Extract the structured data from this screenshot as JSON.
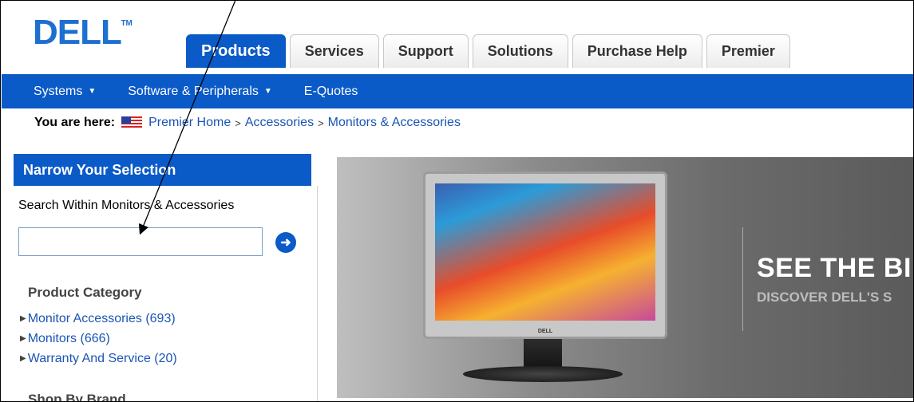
{
  "logo": {
    "text": "DELL",
    "tm": "TM"
  },
  "tabs": [
    {
      "label": "Products",
      "active": true
    },
    {
      "label": "Services",
      "active": false
    },
    {
      "label": "Support",
      "active": false
    },
    {
      "label": "Solutions",
      "active": false
    },
    {
      "label": "Purchase Help",
      "active": false
    },
    {
      "label": "Premier",
      "active": false
    }
  ],
  "nav": [
    {
      "label": "Systems",
      "dropdown": true
    },
    {
      "label": "Software & Peripherals",
      "dropdown": true
    },
    {
      "label": "E-Quotes",
      "dropdown": false
    }
  ],
  "breadcrumb": {
    "label": "You are here:",
    "items": [
      "Premier Home",
      "Accessories",
      "Monitors & Accessories"
    ],
    "separator": ">"
  },
  "sidebar": {
    "header": "Narrow Your Selection",
    "search_label": "Search Within Monitors & Accessories",
    "search_value": "",
    "go_icon": "arrow-right-circle-icon",
    "category_heading": "Product Category",
    "categories": [
      "Monitor Accessories (693)",
      "Monitors (666)",
      "Warranty And Service (20)"
    ],
    "shop_heading": "Shop By Brand"
  },
  "banner": {
    "monitor_brand": "DELL",
    "headline": "SEE THE BI",
    "subline": "DISCOVER DELL'S S"
  },
  "colors": {
    "dell_blue": "#0a5ac8",
    "link": "#1a55b3"
  }
}
